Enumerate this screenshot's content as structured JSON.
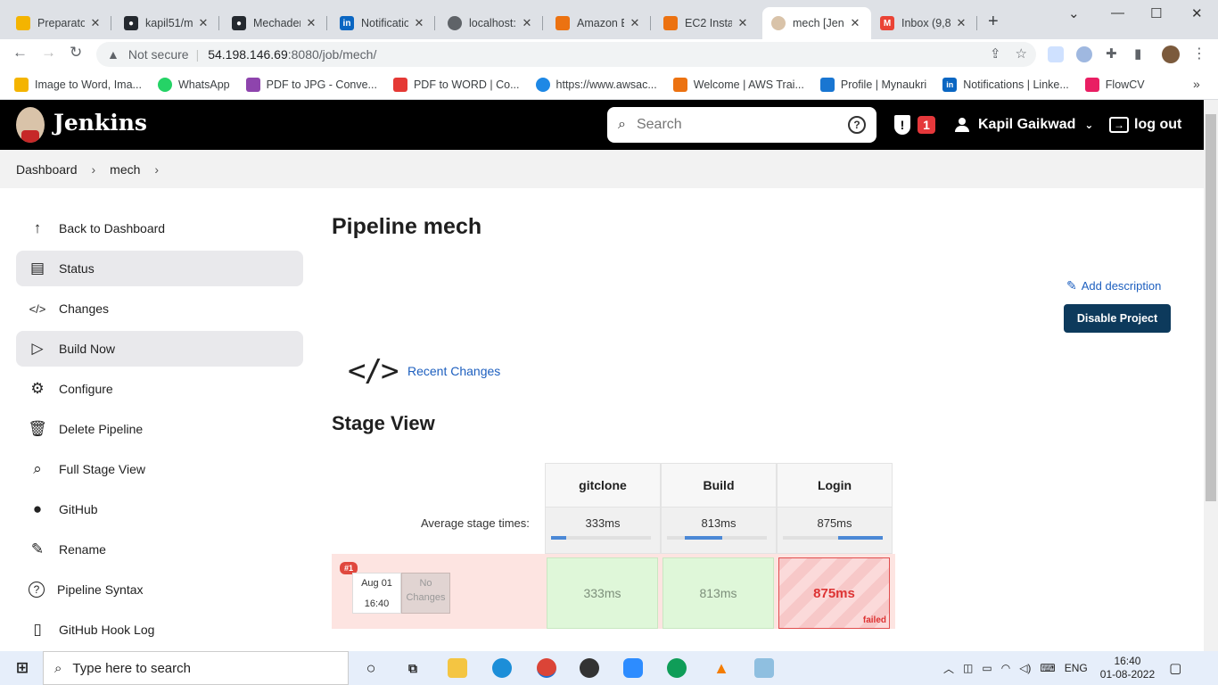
{
  "browser": {
    "tabs": [
      {
        "title": "Preparator",
        "color": "#f4b400"
      },
      {
        "title": "kapil51/m",
        "color": "#24292f"
      },
      {
        "title": "Mechadem",
        "color": "#24292f"
      },
      {
        "title": "Notificatio",
        "color": "#0a66c2"
      },
      {
        "title": "localhost:8",
        "color": "#5f6368"
      },
      {
        "title": "Amazon E",
        "color": "#ec7211"
      },
      {
        "title": "EC2 Instan",
        "color": "#ec7211"
      },
      {
        "title": "mech [Jen",
        "color": "#d9c3a9"
      },
      {
        "title": "Inbox (9,8",
        "color": "#ea4335"
      }
    ],
    "address": {
      "security": "Not secure",
      "host": "54.198.146.69",
      "path": ":8080/job/mech/"
    },
    "bookmarks": [
      {
        "label": "Image to Word, Ima...",
        "color": "#f4b400"
      },
      {
        "label": "WhatsApp",
        "color": "#25d366"
      },
      {
        "label": "PDF to JPG - Conve...",
        "color": "#8e44ad"
      },
      {
        "label": "PDF to WORD | Co...",
        "color": "#e53935"
      },
      {
        "label": "https://www.awsac...",
        "color": "#1e88e5"
      },
      {
        "label": "Welcome | AWS Trai...",
        "color": "#ec7211"
      },
      {
        "label": "Profile | Mynaukri",
        "color": "#1976d2"
      },
      {
        "label": "Notifications | Linke...",
        "color": "#0a66c2"
      },
      {
        "label": "FlowCV",
        "color": "#e91e63"
      }
    ]
  },
  "jenkins": {
    "title": "Jenkins",
    "search_placeholder": "Search",
    "help": "?",
    "alert_count": "1",
    "user": "Kapil Gaikwad",
    "logout": "log out"
  },
  "breadcrumb": {
    "root": "Dashboard",
    "job": "mech"
  },
  "sidebar": {
    "items": [
      {
        "label": "Back to Dashboard",
        "icon": "↑"
      },
      {
        "label": "Status",
        "icon": "▤"
      },
      {
        "label": "Changes",
        "icon": "</>"
      },
      {
        "label": "Build Now",
        "icon": "▷"
      },
      {
        "label": "Configure",
        "icon": "⚙"
      },
      {
        "label": "Delete Pipeline",
        "icon": "🗑"
      },
      {
        "label": "Full Stage View",
        "icon": "⌕"
      },
      {
        "label": "GitHub",
        "icon": "●"
      },
      {
        "label": "Rename",
        "icon": "✎"
      },
      {
        "label": "Pipeline Syntax",
        "icon": "?"
      },
      {
        "label": "GitHub Hook Log",
        "icon": "▯"
      }
    ]
  },
  "main": {
    "title": "Pipeline mech",
    "add_description": "Add description",
    "disable_button": "Disable Project",
    "recent_changes": "Recent Changes",
    "stage_view_title": "Stage View"
  },
  "stage_view": {
    "avg_label": "Average stage times:",
    "stages": [
      {
        "name": "gitclone",
        "avg": "333ms",
        "run": "333ms",
        "status": "success",
        "fill_start": 0.0,
        "fill_end": 0.15
      },
      {
        "name": "Build",
        "avg": "813ms",
        "run": "813ms",
        "status": "success",
        "fill_start": 0.18,
        "fill_end": 0.55
      },
      {
        "name": "Login",
        "avg": "875ms",
        "run": "875ms",
        "status": "failed",
        "fill_start": 0.55,
        "fill_end": 1.0
      }
    ],
    "run": {
      "number": "#1",
      "date": "Aug 01",
      "time": "16:40",
      "changes": "No Changes",
      "failed_label": "failed"
    }
  },
  "taskbar": {
    "search": "Type here to search",
    "lang": "ENG",
    "time": "16:40",
    "date": "01-08-2022"
  }
}
